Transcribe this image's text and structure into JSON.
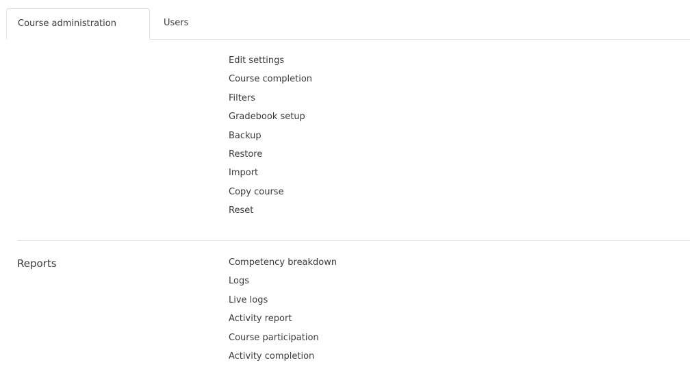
{
  "tabs": {
    "course_administration": "Course administration",
    "users": "Users"
  },
  "course_section": {
    "title": "",
    "links": [
      "Edit settings",
      "Course completion",
      "Filters",
      "Gradebook setup",
      "Backup",
      "Restore",
      "Import",
      "Copy course",
      "Reset"
    ]
  },
  "reports_section": {
    "title": "Reports",
    "links": [
      "Competency breakdown",
      "Logs",
      "Live logs",
      "Activity report",
      "Course participation",
      "Activity completion"
    ]
  }
}
